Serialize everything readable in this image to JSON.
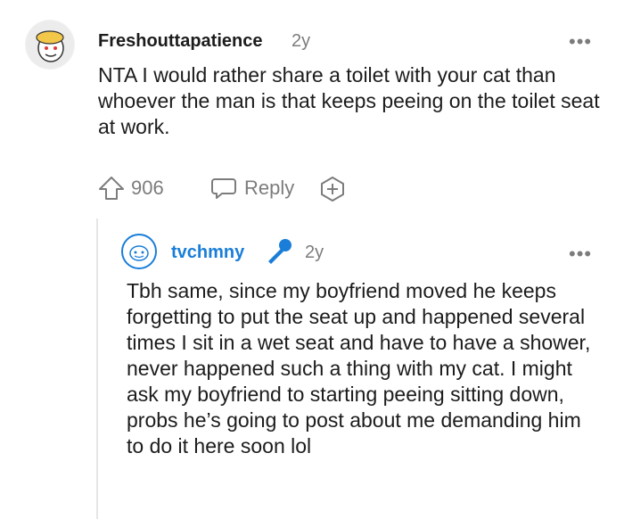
{
  "comment": {
    "username": "Freshouttapatience",
    "age": "2y",
    "text": "NTA I would rather share a toilet with your cat than whoever the man is that keeps peeing on the toilet seat at work.",
    "votes": "906",
    "reply_label": "Reply",
    "more_label": "•••"
  },
  "reply": {
    "username": "tvchmny",
    "age": "2y",
    "text": "Tbh same, since my boyfriend moved he keeps forgetting to put the seat up and happened several times I sit in a wet seat and have to have a shower, never happened such a thing with my cat. I might ask my boyfriend to starting peeing sitting down, probs he’s going to post about me demanding him to do it here soon lol",
    "more_label": "•••"
  },
  "colors": {
    "accent": "#1a7ed8",
    "muted": "#7c7c7c"
  }
}
